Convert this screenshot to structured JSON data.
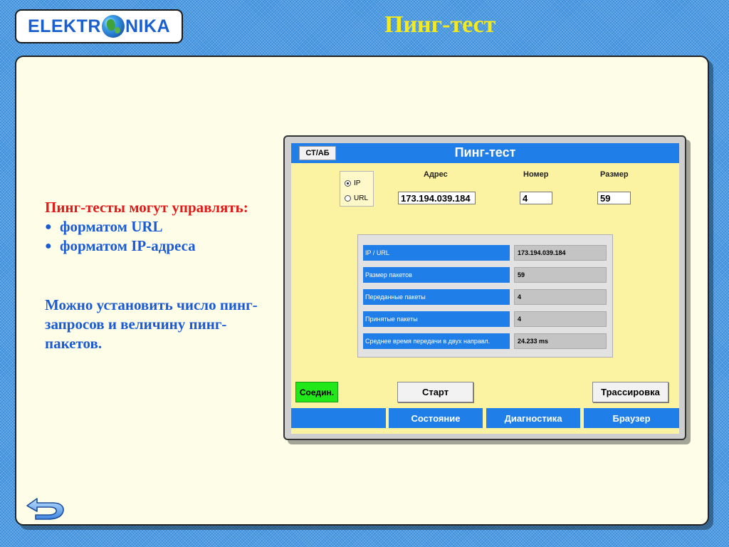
{
  "logo": {
    "left": "ELEKTR",
    "right": "NIKA"
  },
  "slide_title": "Пинг-тест",
  "description": {
    "heading": "Пинг-тесты могут управлять:",
    "bullets": [
      "форматом URL",
      "форматом IP-адреса"
    ],
    "bullet_symbol": "●",
    "paragraph": "Можно установить число пинг-запросов и величину пинг-пакетов."
  },
  "hmi": {
    "title": "Пинг-тест",
    "stab_button": "СТ/АБ",
    "mode": {
      "ip_label": "IP",
      "url_label": "URL",
      "selected": "IP"
    },
    "fields": {
      "address_label": "Адрес",
      "address_value": "173.194.039.184",
      "number_label": "Номер",
      "number_value": "4",
      "size_label": "Размер",
      "size_value": "59"
    },
    "results": [
      {
        "label": "IP / URL",
        "value": "173.194.039.184"
      },
      {
        "label": "Размер пакетов",
        "value": "59"
      },
      {
        "label": "Переданные пакеты",
        "value": "4"
      },
      {
        "label": "Принятые пакеты",
        "value": "4"
      },
      {
        "label": "Среднее время передачи в двух направл.",
        "value": "24.233 ms"
      }
    ],
    "connect_button": "Соедин.",
    "start_button": "Старт",
    "trace_button": "Трассировка",
    "nav": [
      "",
      "Состояние",
      "Диагностика",
      "Браузер"
    ]
  },
  "colors": {
    "accent_blue": "#1f7ee8",
    "panel_yellow": "#fbf3a1",
    "connect_green": "#22e81a",
    "title_yellow": "#f5ea1e"
  },
  "icons": {
    "back": "back-arrow-icon",
    "globe": "globe-icon"
  }
}
